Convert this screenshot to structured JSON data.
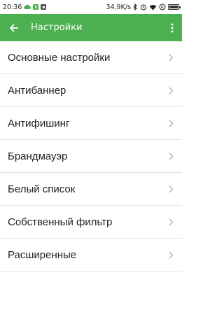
{
  "status_bar": {
    "time": "20:36",
    "net_speed": "34,9K/s",
    "icons": [
      "notification-icon",
      "app-icon",
      "app-icon-2",
      "bluetooth-icon",
      "alarm-icon",
      "wifi-icon",
      "signal-icon",
      "battery-icon"
    ],
    "colors": {
      "notif1": "#4caf50",
      "notif2": "#4caf50",
      "notif3": "#555555"
    },
    "battery_level": 0.85
  },
  "app_bar": {
    "title": "Настройки",
    "back_icon": "arrow-back-icon",
    "menu_icon": "more-vert-icon",
    "color": "#4caf50"
  },
  "settings": {
    "items": [
      {
        "label": "Основные настройки"
      },
      {
        "label": "Антибаннер"
      },
      {
        "label": "Антифишинг"
      },
      {
        "label": "Брандмауэр"
      },
      {
        "label": "Белый список"
      },
      {
        "label": "Собственный фильтр"
      },
      {
        "label": "Расширенные"
      }
    ],
    "chevron_icon": "chevron-right-icon"
  }
}
